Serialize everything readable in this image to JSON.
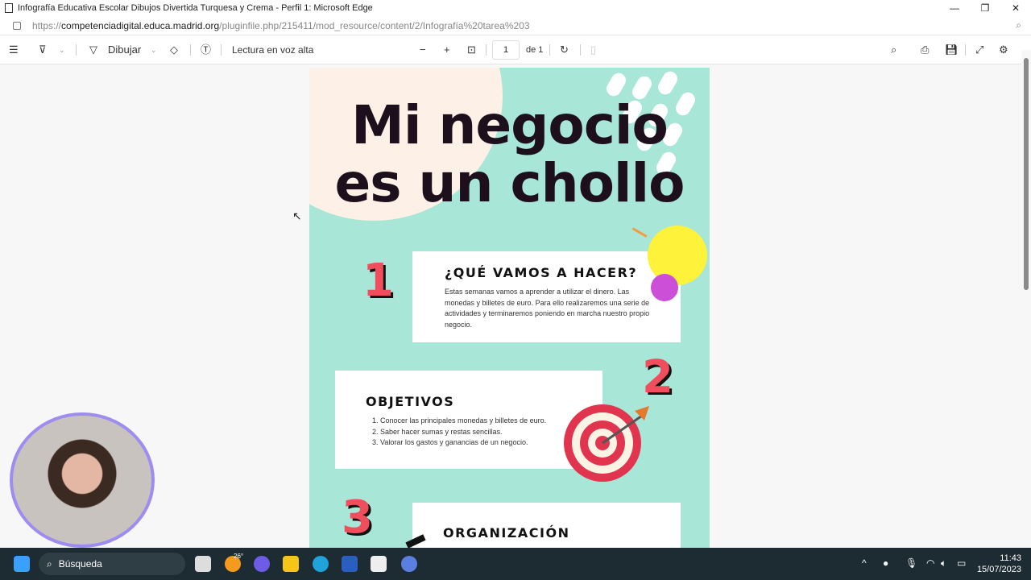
{
  "window": {
    "title": "Infografía Educativa Escolar Dibujos Divertida Turquesa y Crema - Perfil 1: Microsoft Edge"
  },
  "address": {
    "scheme": "https://",
    "domain": "competenciadigital.educa.madrid.org",
    "path": "/pluginfile.php/215411/mod_resource/content/2/Infografía%20tarea%203"
  },
  "toolbar": {
    "draw": "Dibujar",
    "read_aloud": "Lectura en voz alta",
    "page": "1",
    "of": "de 1"
  },
  "doc": {
    "title_line1": "Mi negocio",
    "title_line2": "es un chollo",
    "sections": [
      {
        "num": "1",
        "heading": "¿QUÉ VAMOS A HACER?",
        "text": "Estas semanas vamos a aprender a utilizar el dinero. Las monedas y billetes de euro. Para ello realizaremos una serie de actividades y terminaremos poniendo en marcha nuestro propio negocio."
      },
      {
        "num": "2",
        "heading": "OBJETIVOS",
        "items": [
          "Conocer las principales monedas y billetes de euro.",
          "Saber hacer sumas y restas sencillas.",
          "Valorar los gastos y ganancias de un negocio."
        ]
      },
      {
        "num": "3",
        "heading": "ORGANIZACIÓN"
      }
    ]
  },
  "taskbar": {
    "search": "Búsqueda",
    "weather": "26°",
    "time": "11:43",
    "date": "15/07/2023"
  },
  "colors": {
    "accent": "#a8e6d8",
    "cream": "#fdf0e6",
    "number": "#ef4f5c"
  }
}
